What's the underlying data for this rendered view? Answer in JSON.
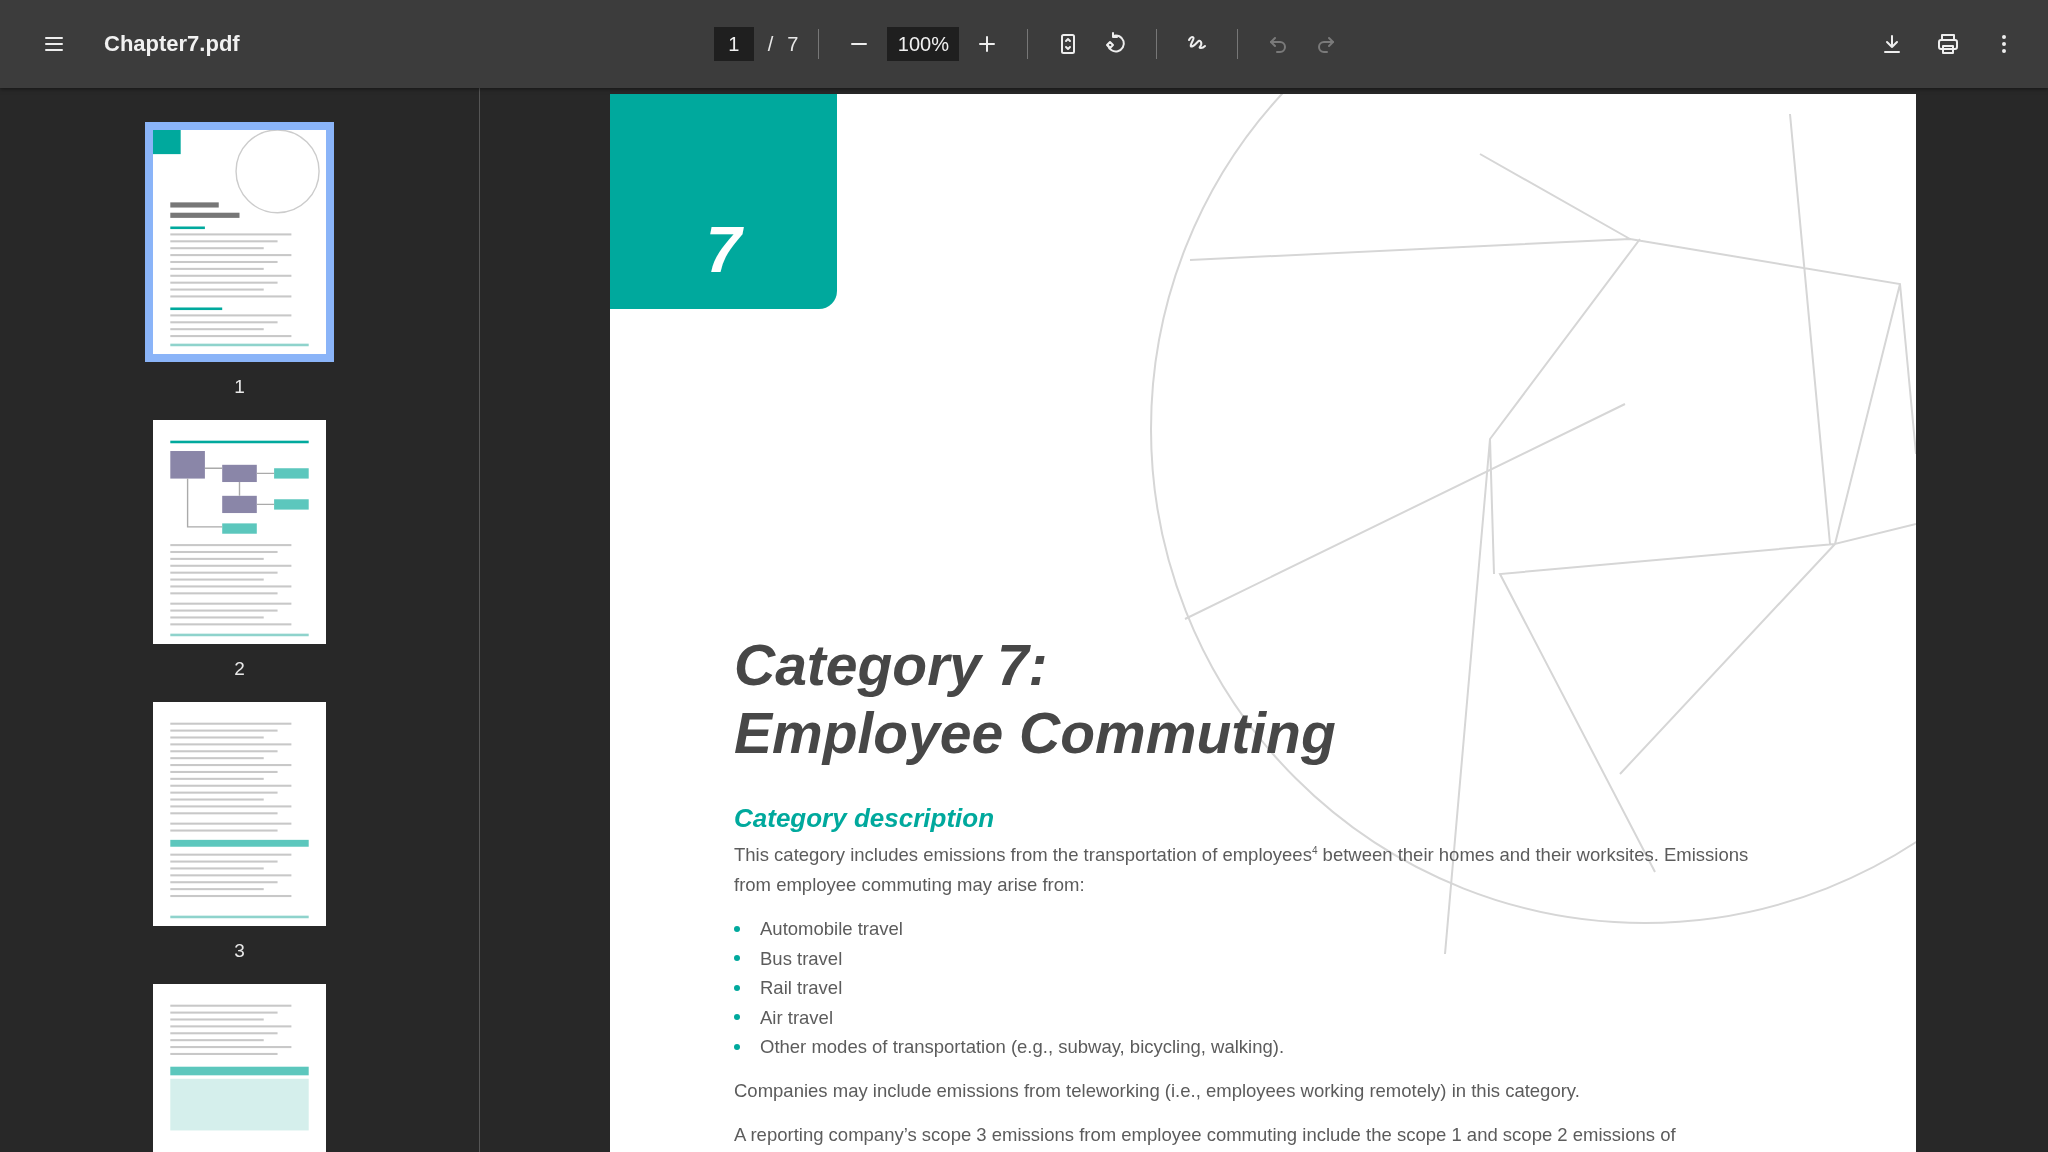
{
  "toolbar": {
    "title": "Chapter7.pdf",
    "page_input": {
      "value": "1"
    },
    "page_separator": "/",
    "page_count": "7",
    "zoom": {
      "value": "100%"
    },
    "undo": {
      "disabled": true
    },
    "redo": {
      "disabled": true
    }
  },
  "thumbnails": [
    {
      "label": "1",
      "selected": true,
      "kind": "cover"
    },
    {
      "label": "2",
      "selected": false,
      "kind": "diagram"
    },
    {
      "label": "3",
      "selected": false,
      "kind": "text"
    },
    {
      "selected": false,
      "kind": "table"
    }
  ],
  "document": {
    "chapter_number": "7",
    "title_lines": [
      "Category 7:",
      "Employee Commuting"
    ],
    "section_heading": "Category description",
    "blocks": [
      {
        "kind": "paragraph",
        "text": "This category includes emissions from the transportation of employees$^{4}$ between their homes and their worksites. Emissions from employee commuting may arise from:"
      },
      {
        "kind": "list",
        "items": [
          "Automobile travel",
          "Bus travel",
          "Rail travel",
          "Air travel",
          "Other modes of transportation (e.g., subway, bicycling, walking)."
        ]
      },
      {
        "kind": "paragraph",
        "text": "Companies may include emissions from teleworking (i.e., employees working remotely) in this category."
      },
      {
        "kind": "paragraph",
        "text": "A reporting company’s scope 3 emissions from employee commuting include the scope 1 and scope 2 emissions of"
      }
    ]
  }
}
